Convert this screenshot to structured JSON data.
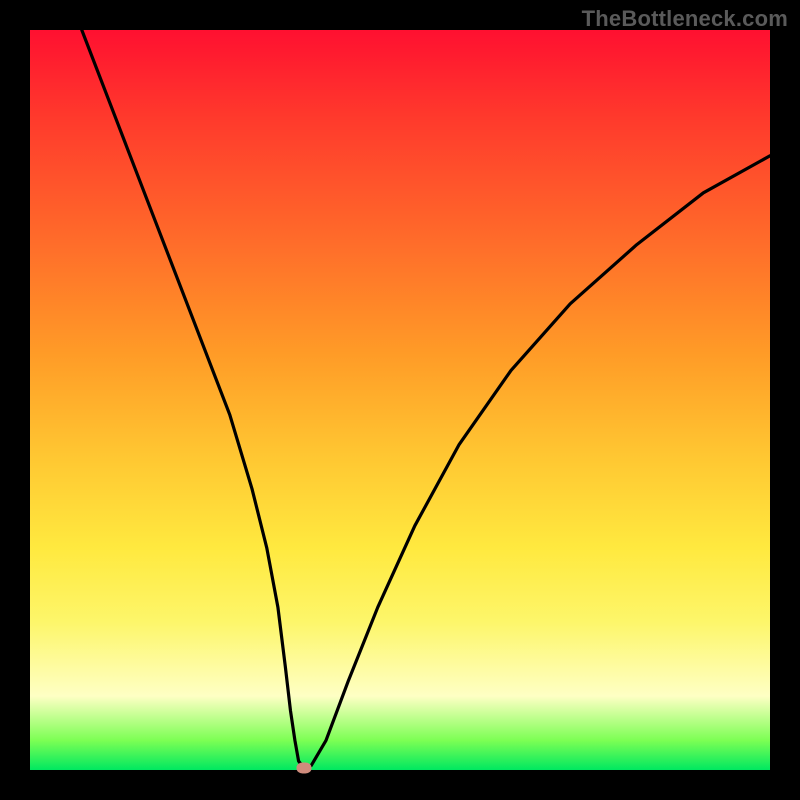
{
  "watermark": "TheBottleneck.com",
  "chart_data": {
    "type": "line",
    "title": "",
    "xlabel": "",
    "ylabel": "",
    "xlim": [
      0,
      100
    ],
    "ylim": [
      0,
      100
    ],
    "grid": false,
    "series": [
      {
        "name": "bottleneck-curve",
        "x": [
          7,
          12,
          17,
          22,
          27,
          30,
          32,
          33.5,
          34.5,
          35.2,
          35.8,
          36.3,
          37.0,
          38.0,
          40.0,
          43.0,
          47.0,
          52.0,
          58.0,
          65.0,
          73.0,
          82.0,
          91.0,
          100.0
        ],
        "y": [
          100,
          87,
          74,
          61,
          48,
          38,
          30,
          22,
          14,
          8,
          4,
          1.2,
          0.3,
          0.6,
          4,
          12,
          22,
          33,
          44,
          54,
          63,
          71,
          78,
          83
        ]
      }
    ],
    "marker": {
      "x": 37.0,
      "y": 0.3
    },
    "gradient_stops": [
      {
        "pos": 0,
        "color": "#ff1030"
      },
      {
        "pos": 12,
        "color": "#ff3a2c"
      },
      {
        "pos": 28,
        "color": "#ff6a2a"
      },
      {
        "pos": 44,
        "color": "#ff9c27"
      },
      {
        "pos": 58,
        "color": "#ffc832"
      },
      {
        "pos": 70,
        "color": "#ffe93f"
      },
      {
        "pos": 80,
        "color": "#fdf66a"
      },
      {
        "pos": 90,
        "color": "#feffc4"
      },
      {
        "pos": 96,
        "color": "#7cff54"
      },
      {
        "pos": 100,
        "color": "#00e860"
      }
    ]
  }
}
